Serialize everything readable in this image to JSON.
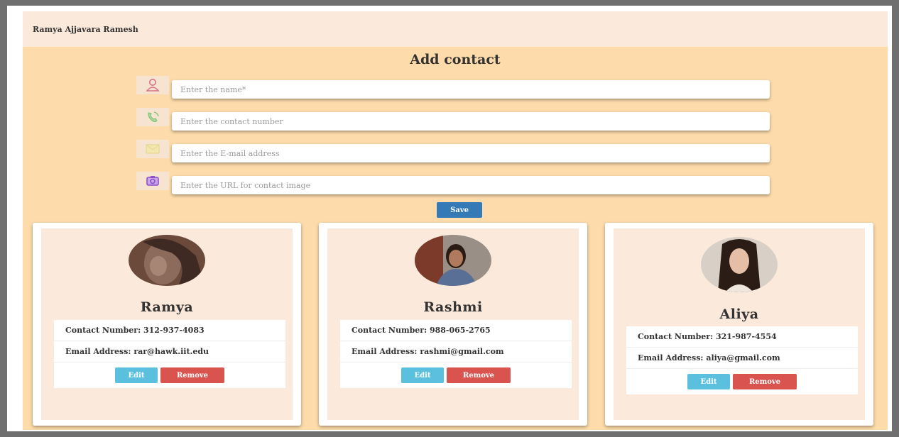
{
  "navbar": {
    "brand": "Ramya Ajjavara Ramesh"
  },
  "form": {
    "title": "Add contact",
    "fields": [
      {
        "icon": "user-icon",
        "placeholder": "Enter the name*",
        "value": ""
      },
      {
        "icon": "phone-icon",
        "placeholder": "Enter the contact number",
        "value": ""
      },
      {
        "icon": "envelope-icon",
        "placeholder": "Enter the E-mail address",
        "value": ""
      },
      {
        "icon": "camera-icon",
        "placeholder": "Enter the URL for contact image",
        "value": ""
      }
    ],
    "save_label": "Save"
  },
  "contacts": [
    {
      "name": "Ramya",
      "contact_label": "Contact Number: 312-937-4083",
      "email_label": "Email Address: rar@hawk.iit.edu",
      "edit_label": "Edit",
      "remove_label": "Remove"
    },
    {
      "name": "Rashmi",
      "contact_label": "Contact Number: 988-065-2765",
      "email_label": "Email Address: rashmi@gmail.com",
      "edit_label": "Edit",
      "remove_label": "Remove"
    },
    {
      "name": "Aliya",
      "contact_label": "Contact Number: 321-987-4554",
      "email_label": "Email Address: aliya@gmail.com",
      "edit_label": "Edit",
      "remove_label": "Remove"
    }
  ],
  "colors": {
    "page_bg": "#fddbaa",
    "navbar_bg": "#fbeadb",
    "primary": "#337ab7",
    "info": "#5bc0de",
    "danger": "#d9534f"
  }
}
